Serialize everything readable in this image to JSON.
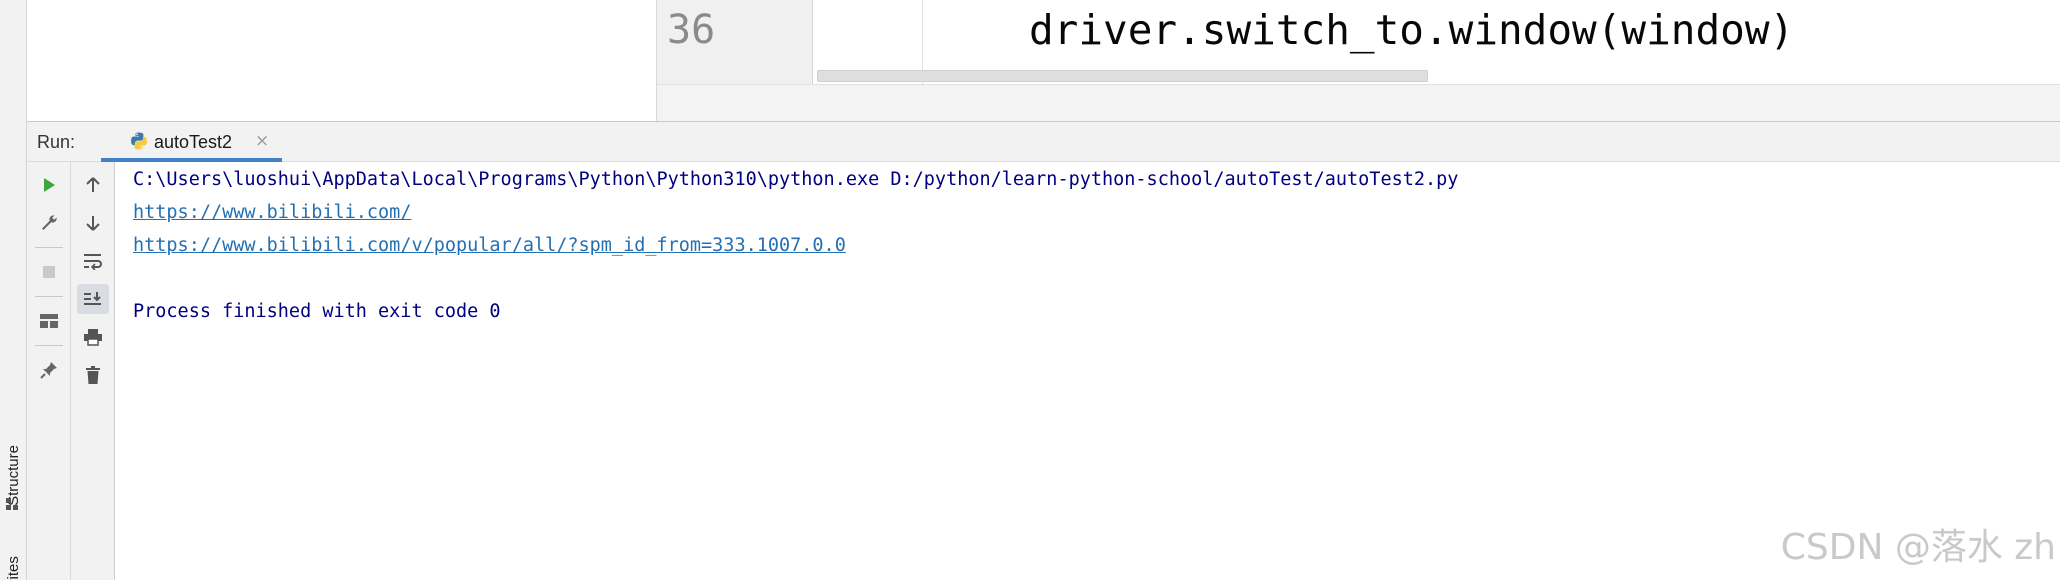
{
  "left_strip": {
    "tabs": [
      {
        "label": "Structure",
        "icon": "structure-icon"
      },
      {
        "label": "orites",
        "icon": "star-icon"
      }
    ]
  },
  "editor": {
    "line_number": "36",
    "code_line": "driver.switch_to.window(window)"
  },
  "run_panel": {
    "label": "Run:",
    "tab": {
      "title": "autoTest2",
      "icon": "python-icon",
      "close_glyph": "×"
    },
    "toolbar_left": [
      {
        "name": "run-icon",
        "color": "#3fa63f"
      },
      {
        "name": "wrench-icon"
      },
      {
        "name": "stop-icon"
      },
      {
        "name": "layout-icon"
      },
      {
        "name": "pin-icon"
      }
    ],
    "toolbar_right": [
      {
        "name": "arrow-up-icon"
      },
      {
        "name": "arrow-down-icon"
      },
      {
        "name": "soft-wrap-icon"
      },
      {
        "name": "scroll-to-end-icon"
      },
      {
        "name": "print-icon"
      },
      {
        "name": "trash-icon"
      }
    ]
  },
  "console": {
    "command": "C:\\Users\\luoshui\\AppData\\Local\\Programs\\Python\\Python310\\python.exe D:/python/learn-python-school/autoTest/autoTest2.py",
    "link1": "https://www.bilibili.com/",
    "link2": "https://www.bilibili.com/v/popular/all/?spm_id_from=333.1007.0.0",
    "exit_message": "Process finished with exit code 0"
  },
  "watermark": "CSDN @落水 zh",
  "colors": {
    "console_text": "#000080",
    "link": "#2470b3",
    "tab_underline": "#4083c9",
    "run_green": "#3fa63f"
  }
}
